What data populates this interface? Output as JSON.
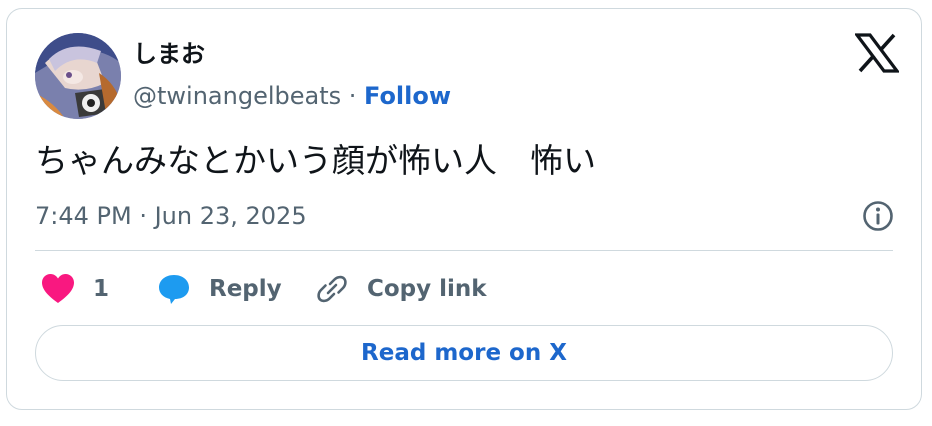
{
  "user": {
    "display_name": "しまお",
    "handle": "@twinangelbeats",
    "separator": " · ",
    "follow_label": "Follow"
  },
  "tweet": {
    "text": "ちゃんみなとかいう顔が怖い人　怖い",
    "timestamp": "7:44 PM · Jun 23, 2025"
  },
  "actions": {
    "like_count": "1",
    "reply_label": "Reply",
    "copy_link_label": "Copy link"
  },
  "footer": {
    "read_more_label": "Read more on X"
  },
  "icons": {
    "brand": "x-logo-icon",
    "info": "info-icon",
    "like": "heart-icon",
    "reply": "speech-bubble-icon",
    "copy": "link-icon"
  },
  "colors": {
    "link_blue": "#1d67cc",
    "heart_pink": "#f91880",
    "reply_blue": "#1d9bf0",
    "muted_text": "#536471",
    "border": "#cfd9de"
  }
}
